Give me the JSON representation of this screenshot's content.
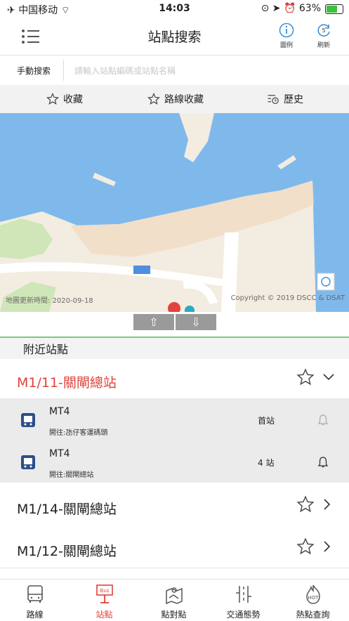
{
  "status_bar": {
    "carrier": "中国移动",
    "time": "14:03",
    "battery": "63%"
  },
  "header": {
    "title": "站點搜索",
    "legend_label": "圖例",
    "refresh_label": "刷新",
    "refresh_count": "5"
  },
  "search": {
    "label": "手動搜索",
    "placeholder": "請輸入站點編碼或站點名稱"
  },
  "fav_tabs": [
    {
      "label": "收藏",
      "icon": "star-icon"
    },
    {
      "label": "路線收藏",
      "icon": "star-icon"
    },
    {
      "label": "歷史",
      "icon": "history-icon"
    }
  ],
  "map": {
    "update_time": "地圖更新時間: 2020-09-18",
    "copyright": "Copyright © 2019 DSCC & DSAT"
  },
  "arrows": {
    "up": "⇧",
    "down": "⇩"
  },
  "nearby": {
    "title": "附近站點",
    "stops": [
      {
        "name": "M1/11-關閘總站",
        "expanded": true,
        "routes": [
          {
            "code": "MT4",
            "destination": "開往:氹仔客運碼頭",
            "status": "首站"
          },
          {
            "code": "MT4",
            "destination": "開往:關閘總站",
            "status": "4 站"
          }
        ]
      },
      {
        "name": "M1/14-關閘總站",
        "expanded": false
      },
      {
        "name": "M1/12-關閘總站",
        "expanded": false
      }
    ]
  },
  "bottom_nav": [
    {
      "label": "路線",
      "icon": "bus-icon",
      "active": false
    },
    {
      "label": "站點",
      "icon": "bus-stop-icon",
      "active": true
    },
    {
      "label": "點對點",
      "icon": "map-route-icon",
      "active": false
    },
    {
      "label": "交通態勢",
      "icon": "traffic-icon",
      "active": false
    },
    {
      "label": "熱點查詢",
      "icon": "hot-icon",
      "active": false
    }
  ],
  "colors": {
    "accent": "#e0433b",
    "bus_icon": "#2b4f8a",
    "water": "#7fb9ec",
    "land": "#f3ece1",
    "park": "#cfe6b8"
  }
}
